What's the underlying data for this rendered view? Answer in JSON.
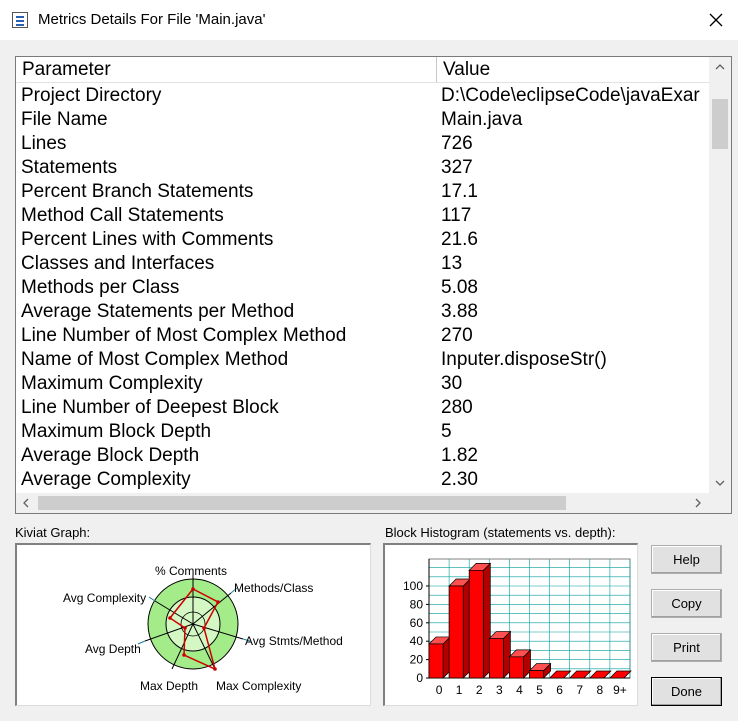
{
  "window": {
    "title": "Metrics Details For File 'Main.java'",
    "close_icon": "close-icon"
  },
  "table": {
    "columns": [
      "Parameter",
      "Value"
    ],
    "rows": [
      {
        "param": "Project Directory",
        "value": "D:\\Code\\eclipseCode\\javaExar"
      },
      {
        "param": "File Name",
        "value": "Main.java"
      },
      {
        "param": "Lines",
        "value": "726"
      },
      {
        "param": "Statements",
        "value": "327"
      },
      {
        "param": "Percent Branch Statements",
        "value": "17.1"
      },
      {
        "param": "Method Call Statements",
        "value": "117"
      },
      {
        "param": "Percent Lines with Comments",
        "value": "21.6"
      },
      {
        "param": "Classes and Interfaces",
        "value": "13"
      },
      {
        "param": "Methods per Class",
        "value": "5.08"
      },
      {
        "param": "Average Statements per Method",
        "value": "3.88"
      },
      {
        "param": "Line Number of Most Complex Method",
        "value": "270"
      },
      {
        "param": "Name of Most Complex Method",
        "value": "Inputer.disposeStr()"
      },
      {
        "param": "Maximum Complexity",
        "value": "30"
      },
      {
        "param": "Line Number of Deepest Block",
        "value": "280"
      },
      {
        "param": "Maximum Block Depth",
        "value": "5"
      },
      {
        "param": "Average Block Depth",
        "value": "1.82"
      },
      {
        "param": "Average Complexity",
        "value": "2.30"
      }
    ]
  },
  "kiviat": {
    "label": "Kiviat Graph:",
    "axes": {
      "comments": "% Comments",
      "methods_class": "Methods/Class",
      "avg_stmts": "Avg Stmts/Method",
      "max_complexity": "Max Complexity",
      "max_depth": "Max Depth",
      "avg_depth": "Avg Depth",
      "avg_complexity": "Avg Complexity"
    },
    "colors": {
      "outer_ring": "#a4ec8a",
      "inner_ring": "#d4f7c4",
      "polygon": "#cc0000"
    }
  },
  "histogram": {
    "label": "Block Histogram (statements vs. depth):",
    "color": "#ff0000"
  },
  "chart_data": {
    "type": "bar",
    "categories": [
      "0",
      "1",
      "2",
      "3",
      "4",
      "5",
      "6",
      "7",
      "8",
      "9+"
    ],
    "values": [
      37,
      100,
      117,
      43,
      23,
      8,
      0,
      0,
      0,
      0
    ],
    "ylim": [
      0,
      100
    ],
    "yticks": [
      "0",
      "20",
      "40",
      "60",
      "80",
      "100"
    ],
    "xlabel": "",
    "ylabel": "",
    "grid": true
  },
  "buttons": {
    "help": "Help",
    "copy": "Copy",
    "print": "Print",
    "done": "Done"
  }
}
